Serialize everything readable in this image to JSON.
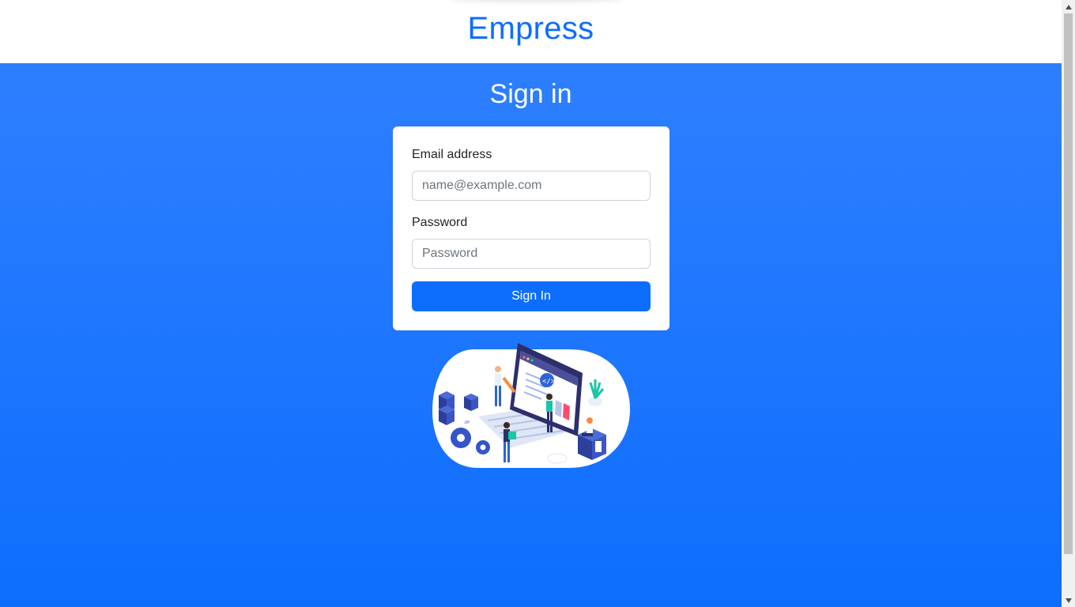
{
  "header": {
    "brand": "Empress"
  },
  "main": {
    "title": "Sign in",
    "form": {
      "email_label": "Email address",
      "email_placeholder": "name@example.com",
      "email_value": "",
      "password_label": "Password",
      "password_placeholder": "Password",
      "password_value": "",
      "submit_label": "Sign In"
    },
    "illustration": "developers-working-on-computer-illustration"
  },
  "colors": {
    "brand": "#0d6efd",
    "hero_top": "#2e7fff",
    "hero_bottom": "#0d6efd",
    "card": "#ffffff"
  },
  "scrollbar": {
    "up_icon": "chevron-up-icon",
    "down_icon": "chevron-down-icon"
  }
}
